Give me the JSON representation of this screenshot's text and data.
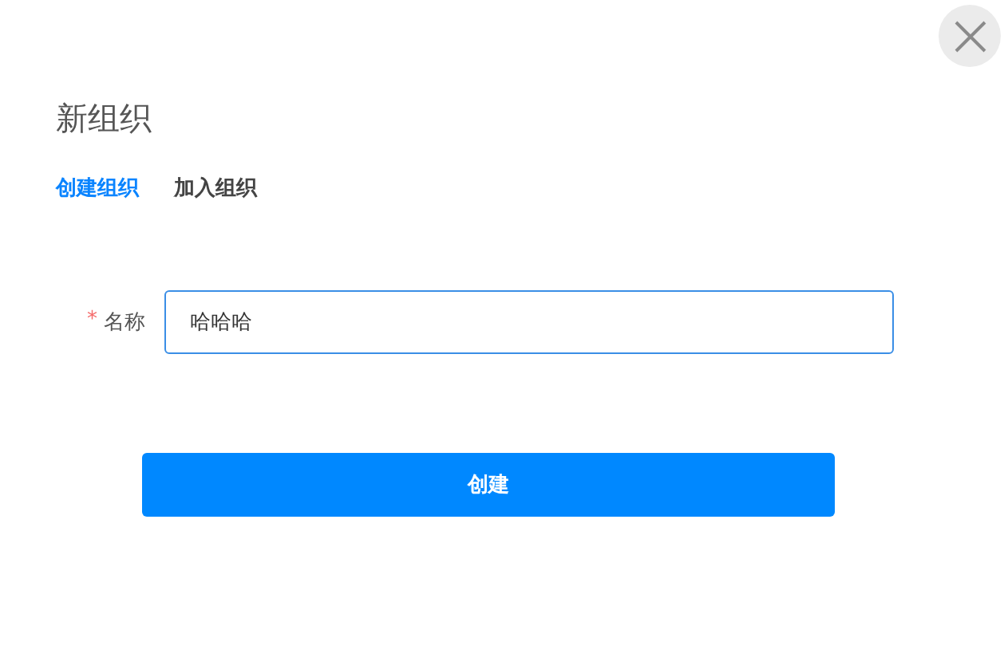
{
  "dialog": {
    "title": "新组织"
  },
  "tabs": [
    {
      "label": "创建组织",
      "selected": true
    },
    {
      "label": "加入组织",
      "selected": false
    }
  ],
  "form": {
    "field": {
      "required_mark": "*",
      "label": "名称",
      "value": "哈哈哈",
      "focused": true
    }
  },
  "submit_button": {
    "label": "创建"
  }
}
